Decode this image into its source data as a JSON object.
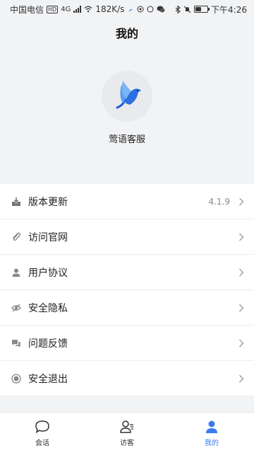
{
  "status_bar": {
    "carrier": "中国电信",
    "badge": "HD",
    "network": "4G",
    "speed": "182K/s",
    "time": "下午4:26",
    "battery_level": 0.5
  },
  "header": {
    "title": "我的"
  },
  "profile": {
    "name": "莺语客服"
  },
  "menu": [
    {
      "label": "版本更新",
      "value": "4.1.9",
      "icon": "download-icon"
    },
    {
      "label": "访问官网",
      "value": "",
      "icon": "paperclip-icon"
    },
    {
      "label": "用户协议",
      "value": "",
      "icon": "user-icon"
    },
    {
      "label": "安全隐私",
      "value": "",
      "icon": "eye-off-icon"
    },
    {
      "label": "问题反馈",
      "value": "",
      "icon": "chat-bubbles-icon"
    },
    {
      "label": "安全退出",
      "value": "",
      "icon": "logout-icon"
    }
  ],
  "tabbar": [
    {
      "label": "会话",
      "icon": "chat-icon",
      "active": false
    },
    {
      "label": "访客",
      "icon": "visitor-icon",
      "active": false
    },
    {
      "label": "我的",
      "icon": "person-icon",
      "active": true
    }
  ],
  "colors": {
    "accent": "#3b7cf0",
    "background": "#f2f3f5"
  }
}
